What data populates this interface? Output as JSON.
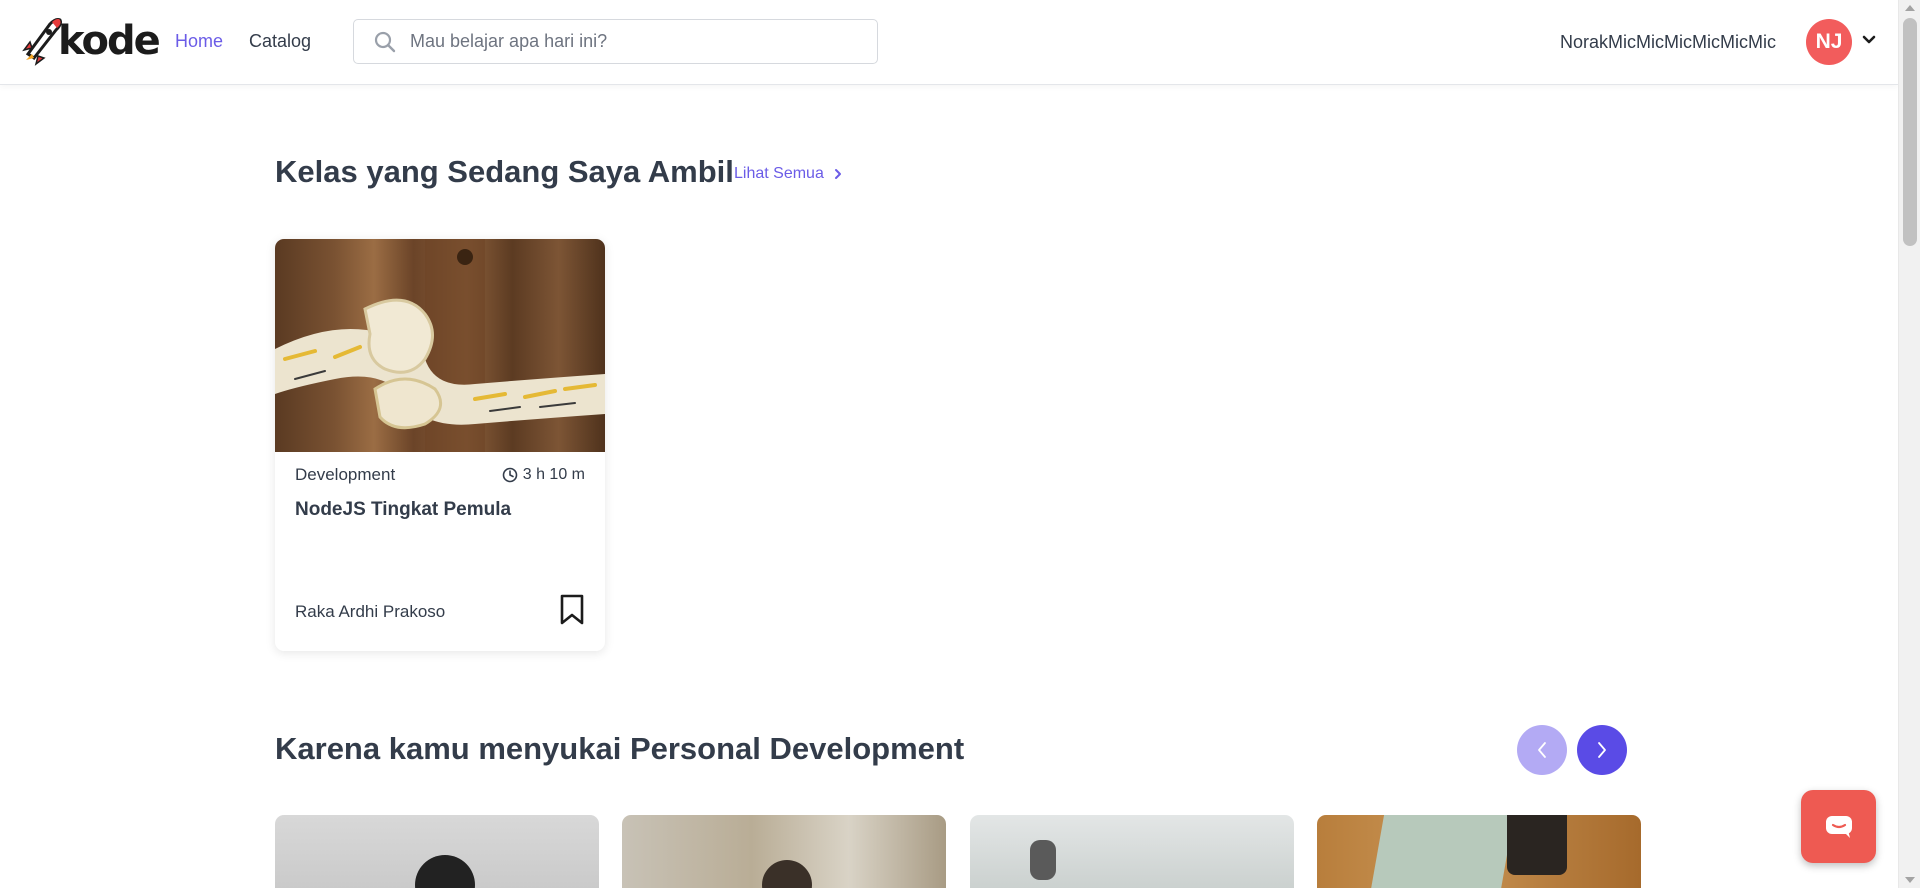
{
  "header": {
    "logo_text": "kode",
    "nav": {
      "home": "Home",
      "catalog": "Catalog"
    },
    "search": {
      "placeholder": "Mau belajar apa hari ini?",
      "value": ""
    },
    "user": {
      "name": "NorakMicMicMicMicMicMic",
      "initials": "NJ"
    }
  },
  "colors": {
    "accent": "#6b5ce7",
    "avatar": "#f25c5c",
    "chat": "#ee5a52",
    "carousel_prev": "#b3aaf4",
    "carousel_next": "#5a4be6"
  },
  "section_ongoing": {
    "title": "Kelas yang Sedang Saya Ambil",
    "see_all": "Lihat Semua",
    "courses": [
      {
        "category": "Development",
        "duration": "3 h 10 m",
        "title": "NodeJS Tingkat Pemula",
        "instructor": "Raka Ardhi Prakoso",
        "bookmark_icon": "bookmark-icon",
        "clock_icon": "clock-icon"
      }
    ]
  },
  "section_recommend": {
    "title": "Karena kamu menyukai Personal Development",
    "prev_icon": "chevron-left-icon",
    "next_icon": "chevron-right-icon"
  },
  "chat": {
    "icon": "chat-icon"
  }
}
